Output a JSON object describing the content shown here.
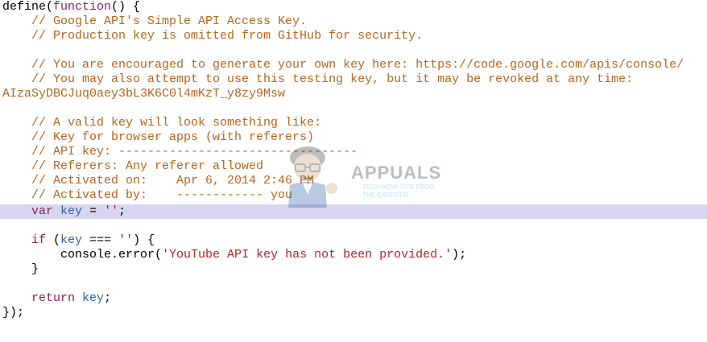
{
  "editor": {
    "highlight_color": "#d6d6f0",
    "colors": {
      "comment": "#b5651d",
      "keyword": "#8b2252",
      "variable": "#2f5fa8",
      "string": "#b22222"
    },
    "lines": {
      "l1": {
        "a": "define(",
        "kw": "function",
        "b": "() {"
      },
      "l2": "    // Google API's Simple API Access Key.",
      "l3": "    // Production key is omitted from GitHub for security.",
      "l4": "",
      "l5": "    // You are encouraged to generate your own key here: https://code.google.com/apis/console/",
      "l6": "    // You may also attempt to use this testing key, but it may be revoked at any time:",
      "l7": "AIzaSyDBCJuq0aey3bL3K6C0l4mKzT_y8zy9Msw",
      "l8": "",
      "l9": "    // A valid key will look something like:",
      "l10": "    // Key for browser apps (with referers)",
      "l11": "    // API key: ---------------------------------",
      "l12": "    // Referers: Any referer allowed",
      "l13": "    // Activated on:    Apr 6, 2014 2:46 PM",
      "l14": "    // Activated by:    ------------ you",
      "l15": {
        "indent": "    ",
        "kw": "var",
        "sp": " ",
        "var": "key",
        "op": " = ",
        "str": "''",
        "end": ";"
      },
      "l16": "",
      "l17": {
        "indent": "    ",
        "kw": "if",
        "a": " (",
        "var": "key",
        "op": " === ",
        "str": "''",
        "b": ") {"
      },
      "l18": {
        "a": "        console.error(",
        "str": "'YouTube API key has not been provided.'",
        "b": ");"
      },
      "l19": "    }",
      "l20": "",
      "l21": {
        "indent": "    ",
        "kw": "return",
        "sp": " ",
        "var": "key",
        "end": ";"
      },
      "l22": "});"
    }
  },
  "watermark": {
    "brand": "APPUALS",
    "tagline_1": "TECH HOW-TO'S FROM",
    "tagline_2": "THE EXPERTS!",
    "icon": "mascot-icon"
  }
}
